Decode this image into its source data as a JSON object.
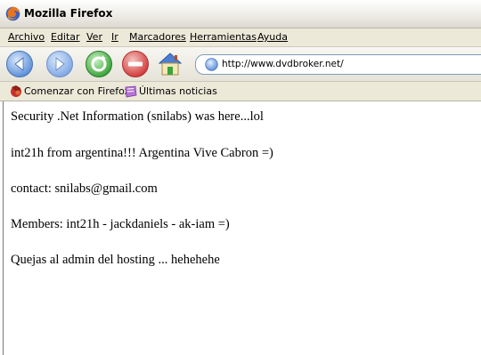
{
  "window": {
    "title": "Mozilla Firefox"
  },
  "menubar": {
    "items": [
      "Archivo",
      "Editar",
      "Ver",
      "Ir",
      "Marcadores",
      "Herramientas",
      "Ayuda"
    ]
  },
  "toolbar": {
    "buttons": [
      "back-icon",
      "forward-icon",
      "reload-icon",
      "stop-icon",
      "home-icon"
    ],
    "url": "http://www.dvdbroker.net/"
  },
  "bookmarks": {
    "items": [
      {
        "label": "Comenzar con Firefox",
        "icon": "firefox-bookmark-icon"
      },
      {
        "label": "Últimas noticias",
        "icon": "rss-feed-icon"
      }
    ]
  },
  "content": {
    "lines": [
      "Security .Net Information (snilabs) was here...lol",
      "int21h from argentina!!! Argentina Vive Cabron =)",
      "contact: snilabs@gmail.com",
      "Members: int21h - jackdaniels - ak-iam =)",
      "Quejas al admin del hosting ... hehehehe"
    ]
  },
  "colors": {
    "menubar_bg": "#ece9d8",
    "nav_button_blue": "#5b8fd8",
    "reload_green": "#3aa33a",
    "stop_red": "#d23a3a"
  }
}
